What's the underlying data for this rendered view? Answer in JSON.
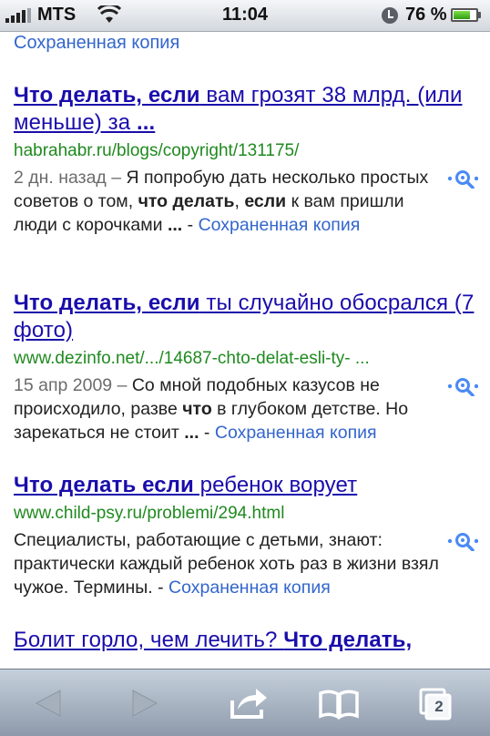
{
  "status_bar": {
    "carrier": "MTS",
    "time": "11:04",
    "battery_percent": "76 %",
    "battery_level": 0.76
  },
  "cache_label_top": "Сохраненная копия",
  "results": [
    {
      "title_bold": "Что делать, если",
      "title_rest": " вам грозят 38 млрд. (или меньше) за ",
      "title_tail_bold": "...",
      "url": "habrahabr.ru/blogs/copyright/131175/",
      "date": "2 дн. назад – ",
      "snippet_1": "Я попробую дать несколько простых советов о том, ",
      "snippet_b1": "что делать",
      "snippet_2": ", ",
      "snippet_b2": "если",
      "snippet_3": " к вам пришли люди с корочками ",
      "snippet_b3": "...",
      "snippet_4": " - ",
      "cache": "Сохраненная копия"
    },
    {
      "title_bold": "Что делать, если",
      "title_rest": " ты случайно обосрался (7 фото)",
      "url": "www.dezinfo.net/.../14687-chto-delat-esli-ty- ...",
      "date": "15 апр 2009 – ",
      "snippet_1": "Со мной подобных казусов не происходило, разве ",
      "snippet_b1": "что",
      "snippet_2": " в глубоком детстве. Но зарекаться не стоит ",
      "snippet_b2": "...",
      "snippet_3": " - ",
      "cache": "Сохраненная копия"
    },
    {
      "title_bold": "Что делать если",
      "title_rest": " ребенок ворует",
      "url": "www.child-psy.ru/problemi/294.html",
      "snippet_1": "Специалисты, работающие с детьми, знают: практически каждый ребенок хоть раз в жизни взял чужое. Термины. - ",
      "cache": "Сохраненная копия"
    },
    {
      "title_rest": "Болит горло, чем лечить? ",
      "title_bold": "Что делать,"
    }
  ],
  "toolbar": {
    "tabs_count": "2"
  }
}
